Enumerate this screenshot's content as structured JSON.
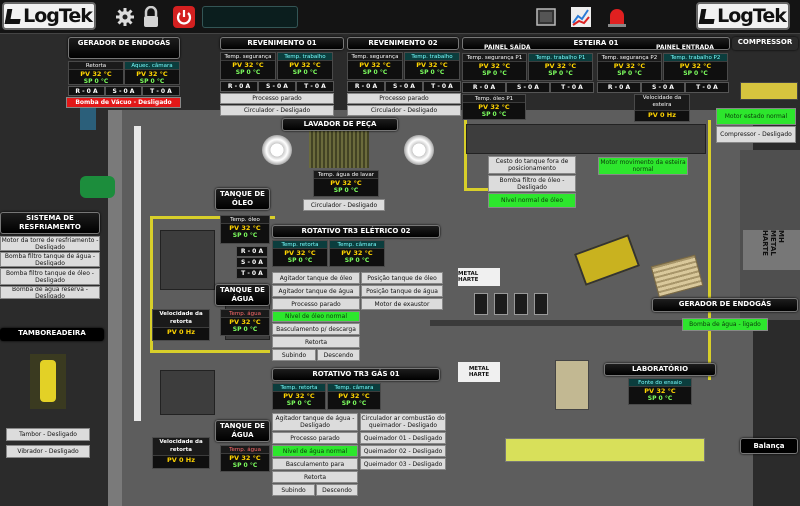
{
  "header": {
    "logo_text": "LogTek",
    "logo_right_text": "LogTek",
    "icons": [
      "gear-icon",
      "lock-icon",
      "power-icon",
      "screen-icon",
      "chart-icon",
      "alarm-icon"
    ],
    "status_text": ""
  },
  "gerador_top": {
    "title": "GERADOR DE ENDOGÁS",
    "col1_label": "Retorta",
    "col2_label": "Aquec. câmara",
    "col1_pv": "PV 32 °C",
    "col1_sp": "SP 0 °C",
    "col2_pv": "PV 32 °C",
    "col2_sp": "SP 0 °C",
    "r": "R - 0 A",
    "s": "S - 0 A",
    "t": "T - 0 A",
    "alarm": "Bomba de Vácuo - Desligado"
  },
  "revenimento01": {
    "title": "REVENIMENTO 01",
    "col1_label": "Temp. segurança",
    "col2_label": "Temp. trabalho",
    "col1_pv": "PV 32 °C",
    "col1_sp": "SP 0 °C",
    "col2_pv": "PV 32 °C",
    "col2_sp": "SP 0 °C",
    "r": "R - 0 A",
    "s": "S - 0 A",
    "t": "T - 0 A",
    "status1": "Processo parado",
    "status2": "Circulador - Desligado"
  },
  "revenimento02": {
    "title": "REVENIMENTO 02",
    "col1_label": "Temp. segurança",
    "col2_label": "Temp. trabalho",
    "col1_pv": "PV 32 °C",
    "col1_sp": "SP 0 °C",
    "col2_pv": "PV 32 °C",
    "col2_sp": "SP 0 °C",
    "r": "R - 0 A",
    "s": "S - 0 A",
    "t": "T - 0 A",
    "status1": "Processo parado",
    "status2": "Circulador - Desligado"
  },
  "esteira01": {
    "title": "ESTEIRA 01",
    "painel_saida": "PAINEL SAÍDA",
    "painel_entrada": "PAINEL ENTRADA",
    "p1_seg_label": "Temp. segurança P1",
    "p1_trab_label": "Temp. trabalho P1",
    "p2_seg_label": "Temp. segurança P2",
    "p2_trab_label": "Temp. trabalho P2",
    "pv": "PV 32 °C",
    "sp": "SP 0 °C",
    "r": "R - 0 A",
    "s": "S - 0 A",
    "t": "T - 0 A",
    "oleo_p1_label": "Temp. óleo P1",
    "oleo_p1_pv": "PV 32 °C",
    "oleo_p1_sp": "SP 0 °C",
    "vel_label": "Velocidade da esteira",
    "vel_value": "PV 0 Hz",
    "cesto": "Cesto do tanque fora de posicionamento",
    "bomba_oleo": "Bomba filtro de óleo - Desligado",
    "nivel_oleo": "Nível normal de óleo",
    "motor_mov": "Motor movimento da esteira normal"
  },
  "compressor": {
    "title": "COMPRESSOR",
    "motor_status": "Motor estado normal",
    "status": "Compressor - Desligado"
  },
  "lavador": {
    "title": "LAVADOR DE PEÇA",
    "temp_label": "Temp. água de lavar",
    "pv": "PV 32 °C",
    "sp": "SP 0 °C",
    "circulador": "Circulador - Desligado"
  },
  "resfriamento": {
    "title": "SISTEMA DE RESFRIAMENTO",
    "items": [
      "Motor da torre de resfriamento - Desligado",
      "Bomba filtro tanque de água - Desligado",
      "Bomba filtro tanque de óleo - Desligado",
      "Bomba de água reserva - Desligado"
    ]
  },
  "tamboreadeira": {
    "title": "TAMBOREADEIRA",
    "tambor": "Tambor - Desligado",
    "vibrador": "Vibrador - Desligado"
  },
  "tanque_oleo": {
    "title": "TANQUE DE ÓLEO",
    "label": "Temp. óleo",
    "pv": "PV 32 °C",
    "sp": "SP 0 °C",
    "r": "R - 0 A",
    "s": "S - 0 A",
    "t": "T - 0 A"
  },
  "tanque_agua1": {
    "title": "TANQUE DE ÁGUA",
    "label": "Temp. água",
    "pv": "PV 32 °C",
    "sp": "SP 0 °C"
  },
  "tanque_agua2": {
    "title": "TANQUE DE ÁGUA",
    "label": "Temp. água",
    "pv": "PV 32 °C",
    "sp": "SP 0 °C"
  },
  "vel_retorta1": {
    "label": "Velocidade da retorta",
    "value": "PV 0 Hz"
  },
  "vel_retorta2": {
    "label": "Velocidade da retorta",
    "value": "PV 0 Hz"
  },
  "rotativo02": {
    "title": "ROTATIVO TR3 ELÉTRICO 02",
    "col1_label": "Temp. retorta",
    "col2_label": "Temp. câmara",
    "pv": "PV 32 °C",
    "sp": "SP 0 °C",
    "left": [
      "Agitador tanque de óleo",
      "Agitador tanque de água",
      "Processo parado",
      "Nível de óleo normal",
      "Basculamento p/ descarga",
      "Retorta"
    ],
    "right": [
      "Posição tanque de óleo",
      "Posição tanque de água",
      "Motor de exaustor"
    ],
    "subindo": "Subindo",
    "descendo": "Descendo"
  },
  "rotativo01": {
    "title": "ROTATIVO TR3 GÁS 01",
    "col1_label": "Temp. retorta",
    "col2_label": "Temp. câmara",
    "pv": "PV 32 °C",
    "sp": "SP 0 °C",
    "left": [
      "Agitador tanque de água - Desligado",
      "Processo parado",
      "Nível de água normal",
      "Basculamento para",
      "Retorta"
    ],
    "right": [
      "Circulador ar combustão do queimador - Desligado",
      "Queimador 01 - Desligado",
      "Queimador 02 - Desligado",
      "Queimador 03 - Desligado"
    ],
    "subindo": "Subindo",
    "descendo": "Descendo"
  },
  "gerador_right": {
    "title": "GERADOR DE ENDOGÁS",
    "bomba": "Bomba de água - ligado"
  },
  "laboratorio": {
    "title": "LABORATÓRIO",
    "label": "Fonte do ensaio",
    "pv": "PV 32 °C",
    "sp": "SP 0 °C"
  },
  "balanca": {
    "label": "Balança"
  },
  "signs": {
    "metal1": "METAL HARTE",
    "metal2": "METAL HARTE",
    "metal3": "MH METAL HARTE"
  }
}
